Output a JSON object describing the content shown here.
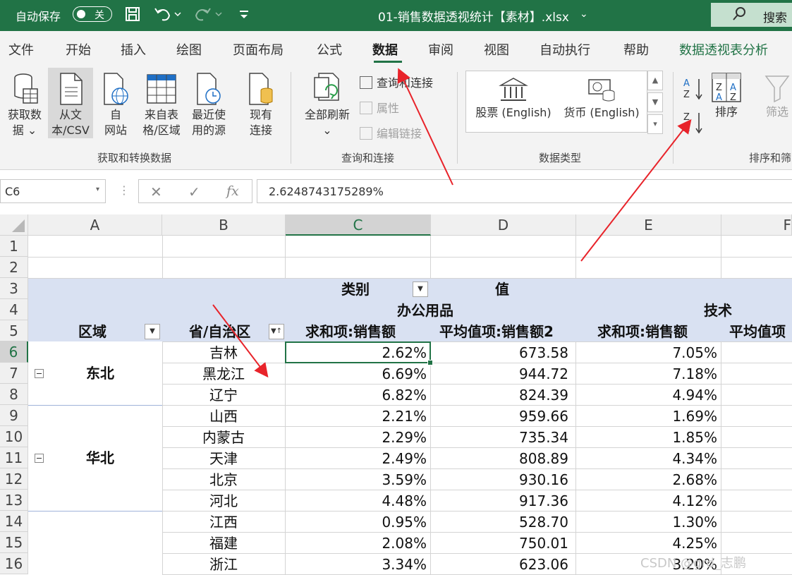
{
  "titlebar": {
    "autosave_label": "自动保存",
    "autosave_state": "关",
    "filename": "01-销售数据透视统计【素材】.xlsx",
    "search_label": "搜索"
  },
  "menu": {
    "tabs": [
      "文件",
      "开始",
      "插入",
      "绘图",
      "页面布局",
      "公式",
      "数据",
      "审阅",
      "视图",
      "自动执行",
      "帮助",
      "数据透视表分析"
    ],
    "active_tab": "数据"
  },
  "ribbon": {
    "get_data": [
      "获取数",
      "据 ⌄"
    ],
    "from_text": [
      "从文",
      "本/CSV"
    ],
    "from_web": [
      "自",
      "网站"
    ],
    "from_table": [
      "来自表",
      "格/区域"
    ],
    "recent_sources": [
      "最近使",
      "用的源"
    ],
    "existing_conn": [
      "现有",
      "连接"
    ],
    "group1_label": "获取和转换数据",
    "refresh_all": [
      "全部刷新",
      "⌄"
    ],
    "queries_conn": "查询和连接",
    "properties": "属性",
    "edit_links": "编辑链接",
    "group2_label": "查询和连接",
    "stocks": "股票 (English)",
    "currency": "货币 (English)",
    "group3_label": "数据类型",
    "sort": "排序",
    "filter": "筛选",
    "group4_label": "排序和筛"
  },
  "formula_bar": {
    "name_box": "C6",
    "fx": "fx",
    "formula": "2.6248743175289%"
  },
  "columns": [
    "A",
    "B",
    "C",
    "D",
    "E",
    "F"
  ],
  "rows": [
    "1",
    "2",
    "3",
    "4",
    "5",
    "6",
    "7",
    "8",
    "9",
    "10",
    "11",
    "12",
    "13",
    "14",
    "15",
    "16"
  ],
  "pivot": {
    "category_label": "类别",
    "values_label": "值",
    "office_label": "办公用品",
    "tech_label": "技术",
    "region_label": "区域",
    "province_label": "省/自治区",
    "col_sum": "求和项:销售额",
    "col_avg": "平均值项:销售额2",
    "col_sum2": "求和项:销售额",
    "col_avg2": "平均值项",
    "regions": [
      "东北",
      "华北"
    ],
    "data_rows": [
      [
        "吉林",
        "2.62%",
        "673.58",
        "7.05%"
      ],
      [
        "黑龙江",
        "6.69%",
        "944.72",
        "7.18%"
      ],
      [
        "辽宁",
        "6.82%",
        "824.39",
        "4.94%"
      ],
      [
        "山西",
        "2.21%",
        "959.66",
        "1.69%"
      ],
      [
        "内蒙古",
        "2.29%",
        "735.34",
        "1.85%"
      ],
      [
        "天津",
        "2.49%",
        "808.89",
        "4.34%"
      ],
      [
        "北京",
        "3.59%",
        "930.16",
        "2.68%"
      ],
      [
        "河北",
        "4.48%",
        "917.36",
        "4.12%"
      ],
      [
        "江西",
        "0.95%",
        "528.70",
        "1.30%"
      ],
      [
        "福建",
        "2.08%",
        "750.01",
        "4.25%"
      ],
      [
        "浙江",
        "3.34%",
        "623.06",
        "3.20%"
      ]
    ]
  },
  "watermark": "CSDN @grd_志鹏",
  "colors": {
    "excel_green": "#217346",
    "pivot_header": "#d9e1f2",
    "arrow_red": "#e8232a"
  }
}
